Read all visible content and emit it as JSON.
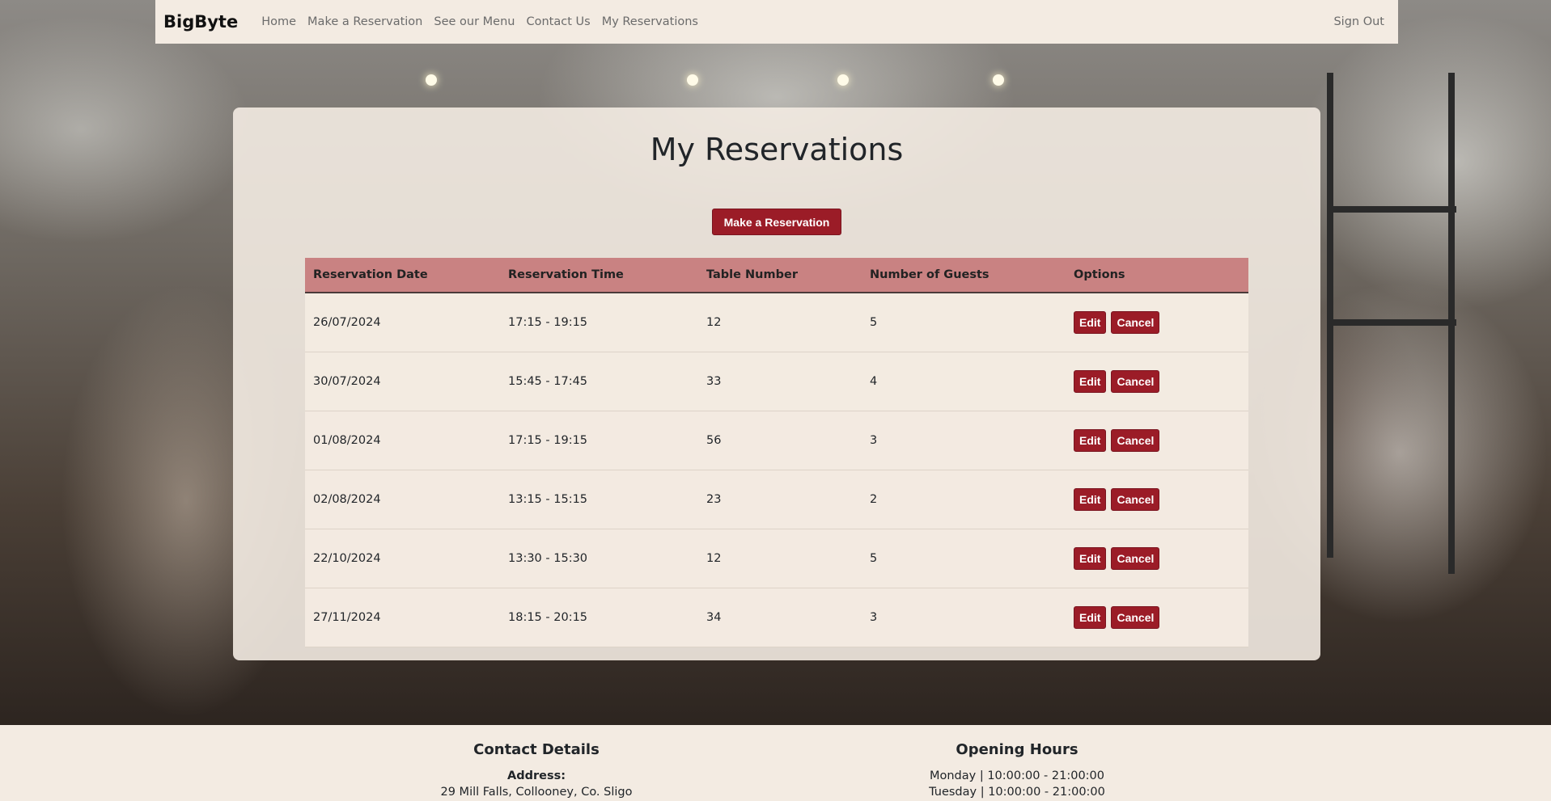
{
  "navbar": {
    "brand": "BigByte",
    "links": [
      "Home",
      "Make a Reservation",
      "See our Menu",
      "Contact Us",
      "My Reservations"
    ],
    "sign_out": "Sign Out"
  },
  "main": {
    "title": "My Reservations",
    "make_reservation_button": "Make a Reservation",
    "table": {
      "headers": [
        "Reservation Date",
        "Reservation Time",
        "Table Number",
        "Number of Guests",
        "Options"
      ],
      "rows": [
        {
          "date": "26/07/2024",
          "time": "17:15 - 19:15",
          "table": "12",
          "guests": "5"
        },
        {
          "date": "30/07/2024",
          "time": "15:45 - 17:45",
          "table": "33",
          "guests": "4"
        },
        {
          "date": "01/08/2024",
          "time": "17:15 - 19:15",
          "table": "56",
          "guests": "3"
        },
        {
          "date": "02/08/2024",
          "time": "13:15 - 15:15",
          "table": "23",
          "guests": "2"
        },
        {
          "date": "22/10/2024",
          "time": "13:30 - 15:30",
          "table": "12",
          "guests": "5"
        },
        {
          "date": "27/11/2024",
          "time": "18:15 - 20:15",
          "table": "34",
          "guests": "3"
        }
      ],
      "edit_label": "Edit",
      "cancel_label": "Cancel"
    }
  },
  "footer": {
    "contact": {
      "heading": "Contact Details",
      "address_label": "Address:",
      "address": "29 Mill Falls, Collooney, Co. Sligo"
    },
    "hours": {
      "heading": "Opening Hours",
      "lines": [
        "Monday | 10:00:00 - 21:00:00",
        "Tuesday | 10:00:00 - 21:00:00"
      ]
    }
  },
  "colors": {
    "accent": "#9b1c27",
    "table_header": "#c98282",
    "panel": "#f3ebe2"
  }
}
